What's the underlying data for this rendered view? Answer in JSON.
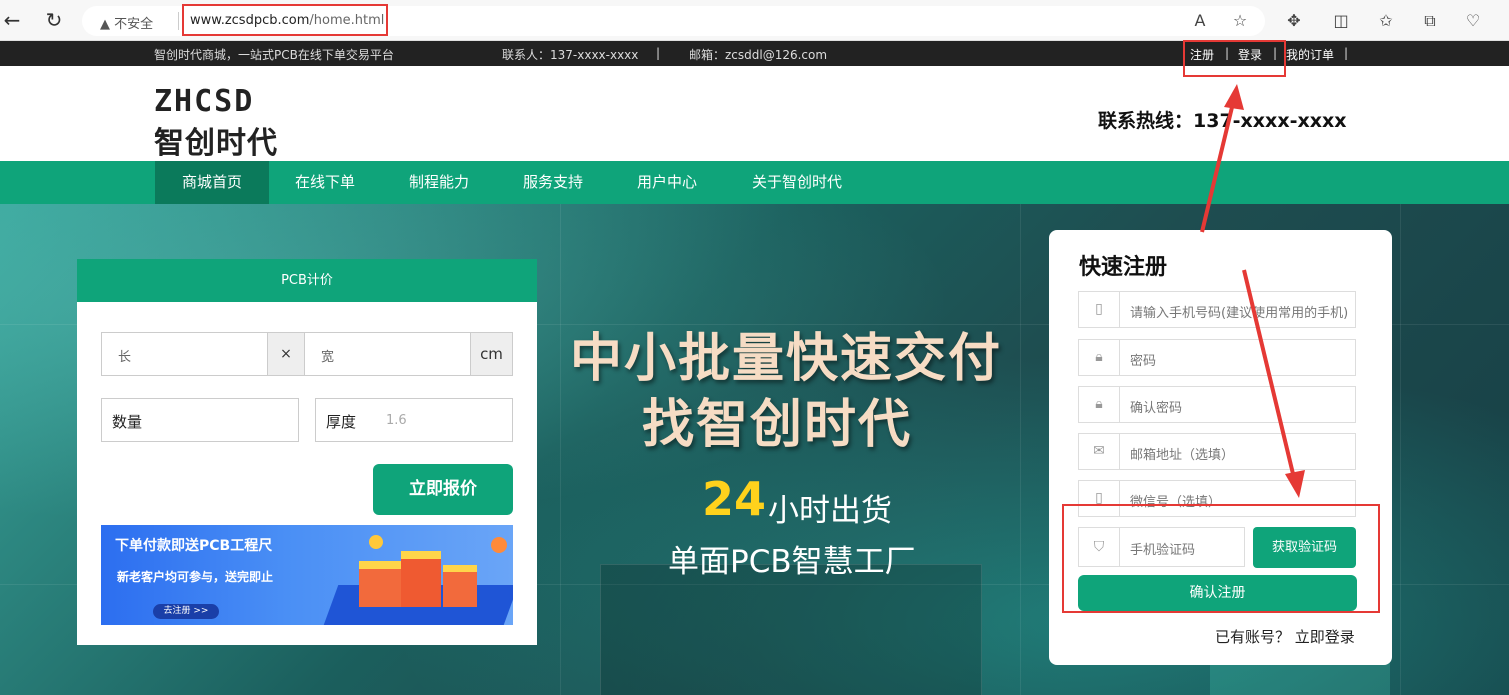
{
  "browser": {
    "insecure_label": "不安全",
    "url_host": "www.zcsdpcb.com",
    "url_path": "/home.html"
  },
  "topbar": {
    "slogan": "智创时代商城，一站式PCB在线下单交易平台",
    "contact": "联系人：137-xxxx-xxxx",
    "sep": "|",
    "email": "邮箱：zcsddl@126.com",
    "register": "注册",
    "login": "登录",
    "orders": "我的订单"
  },
  "header": {
    "logo_en": "ZHCSD",
    "logo_cn": "智创时代",
    "hotline": "联系热线：137-xxxx-xxxx"
  },
  "nav": {
    "items": [
      "商城首页",
      "在线下单",
      "制程能力",
      "服务支持",
      "用户中心",
      "关于智创时代"
    ]
  },
  "hero": {
    "line1": "中小批量快速交付",
    "line2": "找智创时代",
    "hours": "24",
    "line3": "小时出货",
    "line4": "单面PCB智慧工厂"
  },
  "pcb": {
    "title": "PCB计价",
    "length_ph": "长",
    "times": "×",
    "width_ph": "宽",
    "unit": "cm",
    "qty_label": "数量",
    "thickness_label": "厚度",
    "thickness_value": "1.6",
    "quote_btn": "立即报价",
    "promo_title": "下单付款即送PCB工程尺",
    "promo_sub": "新老客户均可参与，送完即止",
    "promo_btn": "去注册 >>"
  },
  "register": {
    "title": "快速注册",
    "phone_ph": "请输入手机号码(建议使用常用的手机)",
    "pwd_ph": "密码",
    "pwd2_ph": "确认密码",
    "email_ph": "邮箱地址（选填）",
    "wechat_ph": "微信号（选填）",
    "code_ph": "手机验证码",
    "get_code": "获取验证码",
    "confirm": "确认注册",
    "have_account": "已有账号？",
    "login_now": "立即登录"
  },
  "colors": {
    "brand_green": "#0fa47a",
    "nav_active": "#0b7a5b",
    "annotation_red": "#e53935"
  }
}
